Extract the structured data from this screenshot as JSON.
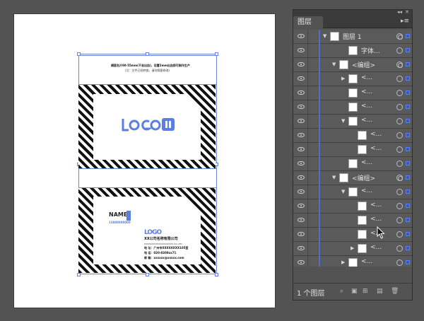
{
  "canvas": {
    "top_card_text": {
      "line1": "横版名片90-55mm(不含出血)，设置2mm出血即可制作生产",
      "line2": "(注：文件已经转曲，请勿随意修改)"
    },
    "front_card": {
      "logo": "LOGO"
    },
    "back_card": {
      "name": "NAME",
      "phone": "13800000000",
      "logo": "LOGO",
      "company": "XX公司名称有限公司",
      "company_en": "XXXXXXXXXXXXXXXXXXXX CO.,LTD",
      "address": "地 址：广州市XXXXXXXX105室",
      "tel": "电 话：020-8300xx71",
      "email": "邮 箱：xxxxxx@xxxxx.com"
    }
  },
  "layers_panel": {
    "tab_label": "图层",
    "layer_count": "1 个图层",
    "rows": [
      {
        "label": "图层 1",
        "indent": 0,
        "expanded": true
      },
      {
        "label": "字体...",
        "indent": 2,
        "expanded": null
      },
      {
        "label": "<编组>",
        "indent": 1,
        "expanded": true
      },
      {
        "label": "<...",
        "indent": 2,
        "expanded": false
      },
      {
        "label": "<...",
        "indent": 2,
        "expanded": null
      },
      {
        "label": "<...",
        "indent": 2,
        "expanded": null
      },
      {
        "label": "<...",
        "indent": 2,
        "expanded": true
      },
      {
        "label": "<...",
        "indent": 3,
        "expanded": null
      },
      {
        "label": "<...",
        "indent": 3,
        "expanded": null
      },
      {
        "label": "<...",
        "indent": 2,
        "expanded": null
      },
      {
        "label": "<编组>",
        "indent": 1,
        "expanded": true
      },
      {
        "label": "<...",
        "indent": 2,
        "expanded": true
      },
      {
        "label": "<...",
        "indent": 3,
        "expanded": null
      },
      {
        "label": "<...",
        "indent": 3,
        "expanded": null
      },
      {
        "label": "<...",
        "indent": 3,
        "expanded": null
      },
      {
        "label": "<...",
        "indent": 3,
        "expanded": false
      },
      {
        "label": "<...",
        "indent": 2,
        "expanded": false
      },
      {
        "label": "<...",
        "indent": 2,
        "expanded": null
      },
      {
        "label": "<...",
        "indent": 2,
        "expanded": null
      },
      {
        "label": "<...",
        "indent": 2,
        "expanded": false
      }
    ]
  },
  "colors": {
    "selection": "#4d6fd1",
    "logo": "#5b7ee5"
  }
}
